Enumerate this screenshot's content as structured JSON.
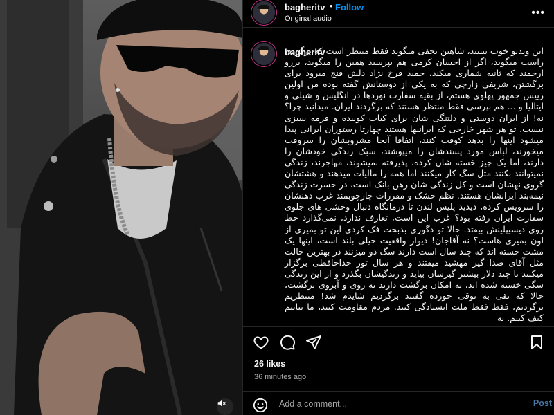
{
  "video": {
    "mute_icon": "speaker-muted-icon"
  },
  "header": {
    "username": "bagheritv",
    "separator": "•",
    "follow_label": "Follow",
    "audio_label": "Original audio",
    "more_icon": "more-options-icon"
  },
  "caption": {
    "username": "bagheritv",
    "text": "این ویدیو خوب ببینید، شاهین نجفی میگوید فقط منتظر است که برگردد، راست میگوید، اگر از احسان کرمی هم بپرسید همین را میگوید، برزو ارجمند که ثانیه شماری میکند، حمید فرخ نژاد دلش قنج میرود برای برگشتن، شریفی زارچی که به یکی از دوستانش گفته بوده من اولین رییس جمهور پهلوی هستم، از بقیه سفارت نوردها در انگلیس و شیلی و ایتالیا و ... هم بپرسی فقط منتظر هستند که برگردند ایران. میدانید چرا؟ نه! از ایران دوستی و دلتنگی شان برای کباب کوبیده و قرمه سبزی نیست. تو هر شهر خارجی که ایرانیها هستند چهارتا رستوران ایرانی پیدا میشود اینها را بدهد کوفت کنند، اتفاقا آنجا مشروبشان را سروقت میخورند، لباس مورد پسندشان را میپوشند، سبک زندگی خودشان را دارند، اما یک چیز خسته شان کرده، پذیرفته نمیشوند، مهاجرند، زندگی نمیتوانند بکنند مثل سگ کار میکنند اما همه را مالیات میدهند و هشتشان گروی نهشان است و کل زندگی شان رهن بانک است، در حسرت زندگی نیمه‌بند ایرانشان هستند. نظم خشک و مقررات چارچوبمند غرب دهنشان را سرویس کرده، دیدید پلیس لندن تا درمانگاه دنبال وحشی های جلوی سفارت ایران رفته بود؟ غرب این است، تعارف ندارد، نمی‌گذارد خط روی دیسیپلینش بیفتد. حالا تو دگوری بدبخت فک کردی این تو بمیری از اون بمیری هاست؟ نه آقاجان! دیوار واقعیت خیلی بلند است، اینها یک مشت خسته اند که چند سال است دارند سگ دو میزنند در بهترین حالت مثل آقای صدا گیر مهشید میفتند و هر سال تور خداحافظی برگزار میکنند تا چند دلار بیشتر گیرشان بیاید و زندگیشان بگذرد و از این زندگی سگی خسته شده اند، نه امکان برگشت دارند نه روی و آبروی برگشت، حالا که تقی به توقی خورده گفتند برگردیم شایدم شد! منتظریم برگردیم، فقط فقط ملت ایستادگی کنند. مردم مقاومت کنید، ما بیاییم کیف کنیم. نه"
  },
  "actions": {
    "like_icon": "heart-icon",
    "comment_icon": "comment-icon",
    "share_icon": "share-icon",
    "save_icon": "bookmark-icon"
  },
  "stats": {
    "likes": "26 likes",
    "time_ago": "36 minutes ago"
  },
  "comment_bar": {
    "emoji_icon": "emoji-icon",
    "placeholder": "Add a comment...",
    "post_label": "Post"
  }
}
